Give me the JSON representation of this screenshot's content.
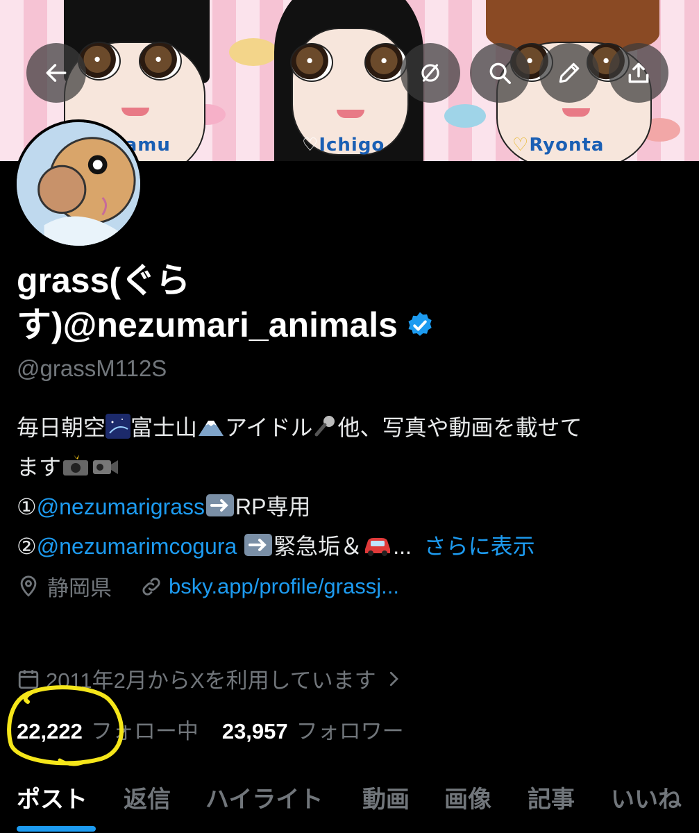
{
  "banner": {
    "names": [
      "Samu",
      "Ichigo",
      "Ryonta"
    ],
    "heart_ichigo": "♡",
    "heart_ryonta": "♡"
  },
  "header_buttons": [
    "back-arrow-icon",
    "grok-icon",
    "search-icon",
    "edit-pencil-icon",
    "share-icon"
  ],
  "profile": {
    "display_name": "grass(ぐらす)@nezumari_animals",
    "handle": "@grassM112S",
    "verified_color": "#1d9bf0"
  },
  "bio": {
    "line1": "毎日朝空",
    "line1b": "富士山",
    "line1c": "アイドル",
    "line1d": "他、写真や動画を載せて",
    "line2": "ます",
    "line3_prefix": "①",
    "line3_link": "@nezumarigrass",
    "line3_suffix": "RP専用",
    "line4_prefix": "②",
    "line4_link": "@nezumarimcogura",
    "line4_suffix": "緊急垢＆",
    "line4_ellipsis": "...",
    "show_more": "さらに表示"
  },
  "meta": {
    "location": "静岡県",
    "url": "bsky.app/profile/grassj..."
  },
  "joined": "2011年2月からXを利用しています",
  "stats": {
    "following_count": "22,222",
    "following_label": "フォロー中",
    "followers_count": "23,957",
    "followers_label": "フォロワー"
  },
  "tabs": [
    "ポスト",
    "返信",
    "ハイライト",
    "動画",
    "画像",
    "記事",
    "いいね"
  ],
  "colors": {
    "accent": "#1d9bf0",
    "muted": "#71767b",
    "highlight_circle": "#f5e61a"
  }
}
